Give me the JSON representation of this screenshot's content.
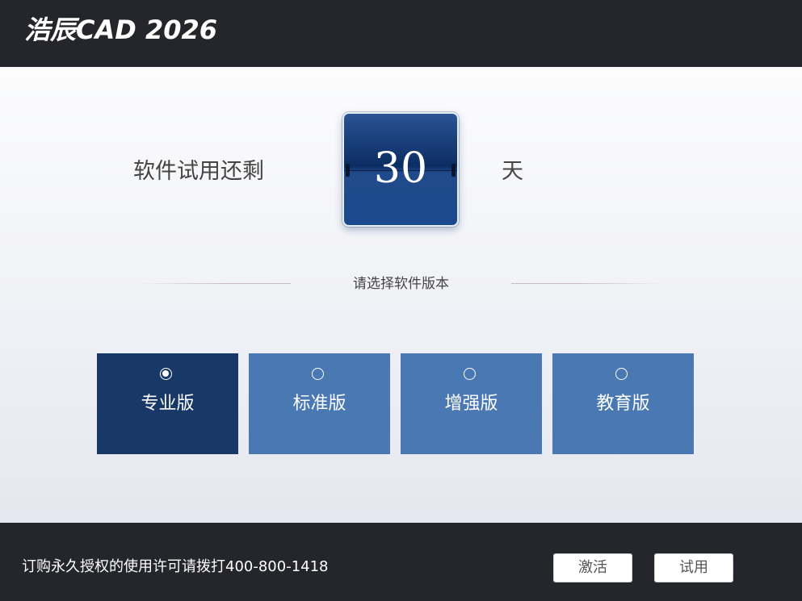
{
  "header": {
    "logo_text": "浩辰CAD 2026"
  },
  "trial": {
    "prefix": "软件试用还剩",
    "days": "30",
    "suffix": "天"
  },
  "choose_label": "请选择软件版本",
  "editions": [
    {
      "label": "专业版",
      "selected": true
    },
    {
      "label": "标准版",
      "selected": false
    },
    {
      "label": "增强版",
      "selected": false
    },
    {
      "label": "教育版",
      "selected": false
    }
  ],
  "footer": {
    "text": "订购永久授权的使用许可请拨打400-800-1418",
    "activate_label": "激活",
    "trial_label": "试用"
  },
  "colors": {
    "header_bg": "#24262b",
    "edition_selected": "#183868",
    "edition_default": "#4a78b2",
    "day_card": "#0c2d63"
  }
}
